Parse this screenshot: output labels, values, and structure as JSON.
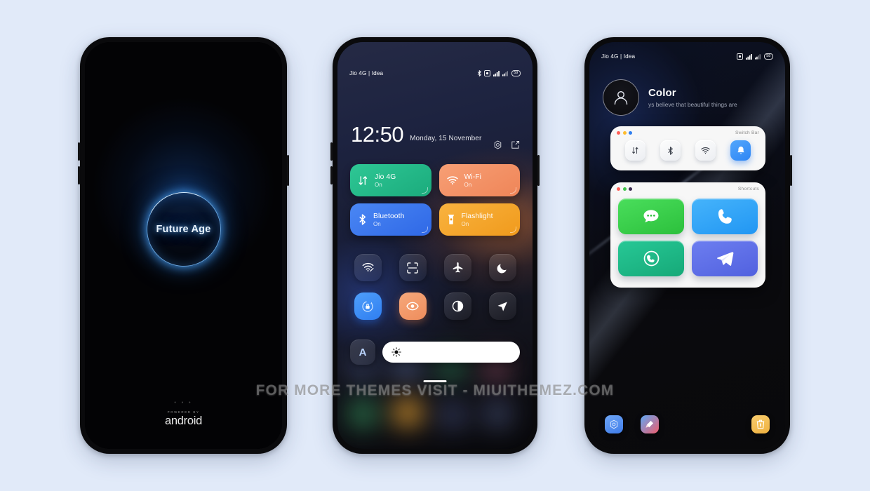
{
  "background_color": "#e1eaf9",
  "watermark": {
    "text": "FOR MORE THEMES VISIT - MIUITHEMEZ.COM"
  },
  "phone1": {
    "name": "splash-screen",
    "ring_label": "Future Age",
    "dots": "• • •",
    "powered_by": "POWERED BY",
    "brand": "android",
    "accent_color": "#58b0ff"
  },
  "phone2": {
    "name": "control-center",
    "status_bar": {
      "carrier": "Jio 4G | Idea",
      "battery": "59"
    },
    "clock": {
      "time": "12:50",
      "date": "Monday, 15 November"
    },
    "clock_icons": [
      {
        "name": "settings-gear-icon"
      },
      {
        "name": "edit-icon"
      }
    ],
    "big_tiles": [
      {
        "label": "Jio 4G",
        "state": "On",
        "icon": "mobile-data-icon",
        "color": "#22bb8a"
      },
      {
        "label": "Wi-Fi",
        "state": "On",
        "icon": "wifi-icon",
        "color": "#f4926a"
      },
      {
        "label": "Bluetooth",
        "state": "On",
        "icon": "bluetooth-icon",
        "color": "#3f7ff0"
      },
      {
        "label": "Flashlight",
        "state": "On",
        "icon": "flashlight-icon",
        "color": "#f5a623"
      }
    ],
    "small_tiles": [
      {
        "icon": "hotspot-icon",
        "active": false
      },
      {
        "icon": "scan-qr-icon",
        "active": false
      },
      {
        "icon": "airplane-mode-icon",
        "active": false
      },
      {
        "icon": "dark-mode-icon",
        "active": false
      },
      {
        "icon": "auto-rotate-icon",
        "active": true,
        "color": "#3f8ef5"
      },
      {
        "icon": "reading-mode-icon",
        "active": true,
        "color": "#f09060"
      },
      {
        "icon": "invert-colors-icon",
        "active": false
      },
      {
        "icon": "location-icon",
        "active": false
      }
    ],
    "brightness": {
      "auto_label": "A",
      "icon": "brightness-sun-icon",
      "level": 100
    }
  },
  "phone3": {
    "name": "home-screen",
    "status_bar": {
      "carrier": "Jio 4G | Idea",
      "battery": "58"
    },
    "profile": {
      "name": "Color",
      "quote": "ys believe that beautiful things are"
    },
    "switch_bar": {
      "title": "Switch Bar",
      "dots": [
        "#ff5f57",
        "#febc2e",
        "#2f7ef0"
      ],
      "switches": [
        {
          "icon": "mobile-data-icon",
          "active": false
        },
        {
          "icon": "bluetooth-icon",
          "active": false
        },
        {
          "icon": "wifi-icon",
          "active": false
        },
        {
          "icon": "bell-icon",
          "active": true
        }
      ]
    },
    "shortcuts": {
      "title": "Shortcuts",
      "dots": [
        "#ff5f57",
        "#3ec24a",
        "#3a2a50"
      ],
      "items": [
        {
          "icon": "messages-icon",
          "color": "#3ed14f"
        },
        {
          "icon": "phone-icon",
          "color": "#36a9f7"
        },
        {
          "icon": "whatsapp-icon",
          "color": "#1eb886"
        },
        {
          "icon": "telegram-icon",
          "color": "#5f72e8"
        }
      ]
    },
    "dock": [
      {
        "icon": "settings-icon",
        "color": "#4c8ff5"
      },
      {
        "icon": "themes-icon",
        "color": "#ef5d6d"
      },
      {
        "icon": "cleaner-icon",
        "color": "#f3bd55"
      }
    ]
  }
}
